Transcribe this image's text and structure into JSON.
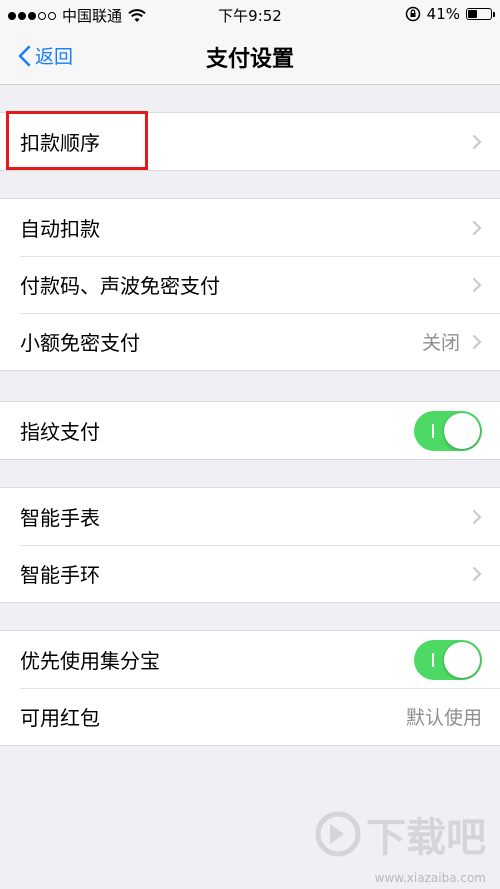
{
  "status_bar": {
    "carrier": "中国联通",
    "time": "下午9:52",
    "battery": "41%",
    "battery_level": 0.41
  },
  "nav": {
    "back_label": "返回",
    "title": "支付设置"
  },
  "groups": [
    {
      "rows": [
        {
          "label": "扣款顺序"
        }
      ]
    },
    {
      "rows": [
        {
          "label": "自动扣款"
        },
        {
          "label": "付款码、声波免密支付"
        },
        {
          "label": "小额免密支付",
          "value": "关闭"
        }
      ]
    },
    {
      "rows": [
        {
          "label": "指纹支付",
          "toggle": true
        }
      ]
    },
    {
      "rows": [
        {
          "label": "智能手表"
        },
        {
          "label": "智能手环"
        }
      ]
    },
    {
      "rows": [
        {
          "label": "优先使用集分宝",
          "toggle": true
        },
        {
          "label": "可用红包",
          "value": "默认使用"
        }
      ]
    }
  ],
  "watermark": {
    "logo_text": "下载吧",
    "url": "www.xiazaiba.com"
  },
  "colors": {
    "accent": "#157efb",
    "toggle_on": "#4cd964",
    "highlight": "#e21a1a"
  }
}
